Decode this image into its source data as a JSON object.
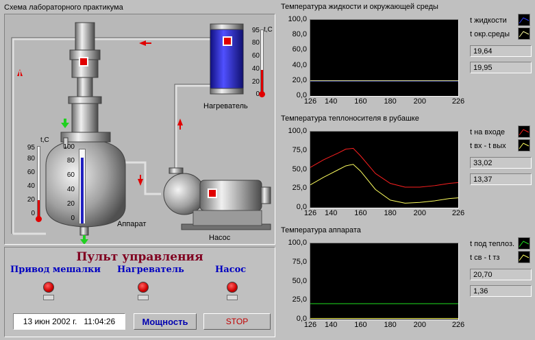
{
  "scheme": {
    "title": "Схема лабораторного практикума",
    "apparatus_label": "Аппарат",
    "heater_label": "Нагреватель",
    "pump_label": "Насос",
    "thermo_unit": "t,C",
    "heater_scale": [
      "95",
      "80",
      "60",
      "40",
      "20",
      "0"
    ],
    "vessel_scale": [
      "95",
      "80",
      "60",
      "40",
      "20",
      "0"
    ],
    "inner_scale": [
      "100",
      "80",
      "60",
      "40",
      "20",
      "0"
    ]
  },
  "control": {
    "title": "Пульт управления",
    "stirrer_label": "Привод мешалки",
    "heater_label": "Нагреватель",
    "pump_label": "Насос",
    "datetime": "13 июн 2002 г.   11:04:26",
    "power_button": "Мощность",
    "stop_button": "STOP"
  },
  "charts": [
    {
      "title": "Температура жидкости и окружающей среды",
      "legend": [
        "t жидкости",
        "t окр.среды"
      ],
      "values": [
        "19,64",
        "19,95"
      ]
    },
    {
      "title": "Температура теплоносителя в рубашке",
      "legend": [
        "t на входе",
        "t вх - t вых"
      ],
      "values": [
        "33,02",
        "13,37"
      ]
    },
    {
      "title": "Температура аппарата",
      "legend": [
        "t под теплоз.",
        "t св - t тз"
      ],
      "values": [
        "20,70",
        "1,36"
      ]
    }
  ],
  "chart_data": [
    {
      "type": "line",
      "ylim": [
        0,
        100
      ],
      "yticks": [
        "100,0",
        "80,0",
        "60,0",
        "40,0",
        "20,0",
        "0,0"
      ],
      "xticks": [
        "126",
        "140",
        "160",
        "180",
        "200",
        "226"
      ],
      "xlim": [
        126,
        226
      ],
      "series": [
        {
          "name": "t жидкости",
          "color": "#3040ff",
          "x": [
            126,
            226
          ],
          "values": [
            19.6,
            19.6
          ]
        },
        {
          "name": "t окр.среды",
          "color": "#ffffa0",
          "x": [
            126,
            226
          ],
          "values": [
            20.0,
            20.0
          ]
        }
      ]
    },
    {
      "type": "line",
      "ylim": [
        0,
        100
      ],
      "yticks": [
        "100,0",
        "75,0",
        "50,0",
        "25,0",
        "0,0"
      ],
      "xticks": [
        "126",
        "140",
        "160",
        "180",
        "200",
        "226"
      ],
      "xlim": [
        126,
        226
      ],
      "series": [
        {
          "name": "t на входе",
          "color": "#ff2020",
          "x": [
            126,
            135,
            145,
            150,
            155,
            160,
            170,
            180,
            190,
            200,
            210,
            220,
            226
          ],
          "values": [
            53,
            63,
            72,
            77,
            78,
            68,
            45,
            32,
            27,
            27,
            29,
            32,
            33
          ]
        },
        {
          "name": "t вх - t вых",
          "color": "#ffff60",
          "x": [
            126,
            135,
            145,
            150,
            155,
            160,
            170,
            180,
            190,
            200,
            210,
            220,
            226
          ],
          "values": [
            30,
            40,
            50,
            55,
            57,
            48,
            24,
            10,
            6,
            7,
            9,
            12,
            13
          ]
        }
      ]
    },
    {
      "type": "line",
      "ylim": [
        0,
        100
      ],
      "yticks": [
        "100,0",
        "75,0",
        "50,0",
        "25,0",
        "0,0"
      ],
      "xticks": [
        "126",
        "140",
        "160",
        "180",
        "200",
        "226"
      ],
      "xlim": [
        126,
        226
      ],
      "series": [
        {
          "name": "t под теплоз.",
          "color": "#20e020",
          "x": [
            126,
            226
          ],
          "values": [
            20.7,
            20.7
          ]
        },
        {
          "name": "t св - t тз",
          "color": "#ffff60",
          "x": [
            126,
            226
          ],
          "values": [
            1.3,
            1.3
          ]
        }
      ]
    }
  ]
}
